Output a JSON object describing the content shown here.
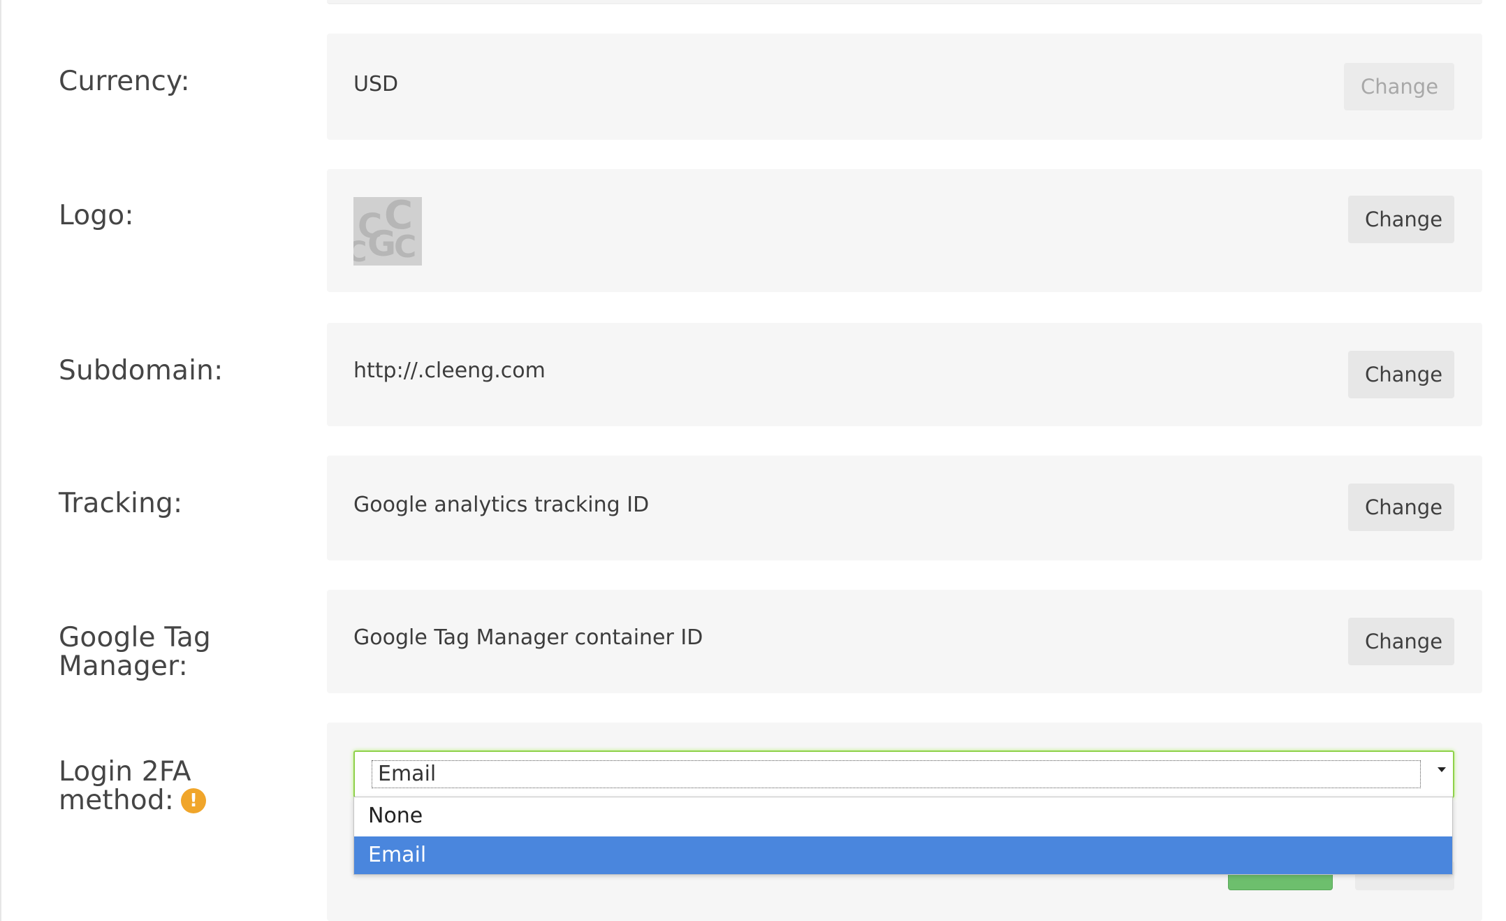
{
  "rows": [
    {
      "label": "Currency:",
      "value": "USD",
      "button": "Change"
    },
    {
      "label": "Logo:",
      "button": "Change"
    },
    {
      "label": "Subdomain:",
      "value": "http://.cleeng.com",
      "button": "Change"
    },
    {
      "label": "Tracking:",
      "value": "Google analytics tracking ID",
      "button": "Change"
    },
    {
      "label": "Google Tag Manager:",
      "value": "Google Tag Manager container ID",
      "button": "Change"
    },
    {
      "label": "Login 2FA method:",
      "icon": "warning-icon",
      "icon_glyph": "!"
    }
  ],
  "login_2fa": {
    "selected": "Email",
    "options": [
      "None",
      "Email"
    ],
    "highlighted_option": "Email"
  },
  "colors": {
    "panel_bg": "#f6f6f6",
    "button_bg": "#e7e7e7",
    "select_focus_border": "#8fd14a",
    "option_highlight": "#4a86dd",
    "warning": "#f0a52a",
    "save_green": "#6dbf6d"
  }
}
